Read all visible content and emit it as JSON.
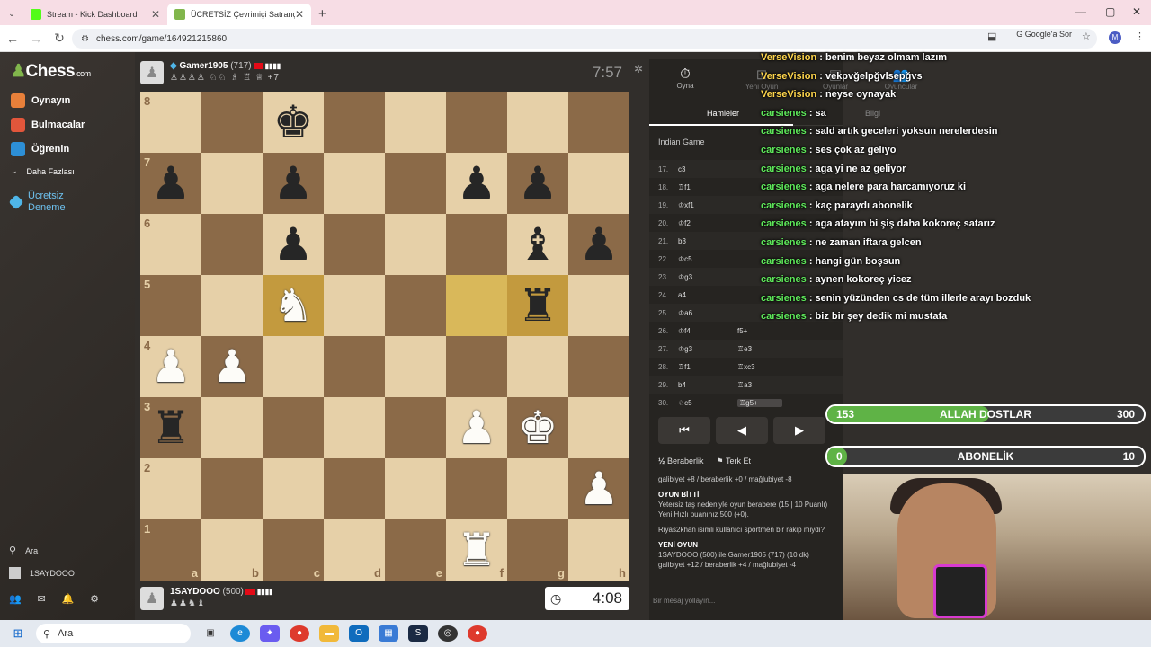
{
  "browser": {
    "tabs": [
      {
        "title": "Stream - Kick Dashboard",
        "close": "✕"
      },
      {
        "title": "ÜCRETSİZ Çevrimiçi Satranç Oy",
        "close": "✕"
      }
    ],
    "new_tab": "+",
    "url": "chess.com/game/164921215860",
    "google_sor": "Google'a Sor",
    "profile": "M"
  },
  "sidebar": {
    "logo": "Chess",
    "logo_suffix": ".com",
    "items": [
      "Oynayın",
      "Bulmacalar",
      "Öğrenin",
      "Daha Fazlası"
    ],
    "trial": "Ücretsiz Deneme",
    "search": "Ara",
    "user": "1SAYDOOO"
  },
  "top_player": {
    "name": "Gamer1905",
    "rating": "(717)",
    "captured": "♙♙♙♙ ♘♘ ♗ ♖ ♕ +7",
    "clock": "7:57"
  },
  "bottom_player": {
    "name": "1SAYDOOO",
    "rating": "(500)",
    "captured": "♟♟♞♝",
    "clock": "4:08"
  },
  "board": {
    "ranks": [
      "8",
      "7",
      "6",
      "5",
      "4",
      "3",
      "2",
      "1"
    ],
    "files": [
      "a",
      "b",
      "c",
      "d",
      "e",
      "f",
      "g",
      "h"
    ],
    "highlight": [
      "c5",
      "f5",
      "g5"
    ],
    "pieces": {
      "c8": "bk",
      "a7": "bp",
      "c7": "bp",
      "f7": "bp",
      "g7": "bp",
      "c6": "bp",
      "g6": "bb",
      "h6": "bp",
      "c5": "wn",
      "g5": "br",
      "a4": "wp",
      "b4": "wp",
      "a3": "br",
      "f3": "wp",
      "g3": "wk",
      "h2": "wp",
      "f1": "wr"
    }
  },
  "panel": {
    "tabs": [
      "Oyna",
      "Yeni Oyun",
      "Oyunlar",
      "Oyuncular"
    ],
    "subtabs": [
      "Hamleler",
      "Bilgi"
    ],
    "opening": "Indian Game",
    "moves": [
      {
        "n": "17.",
        "w": "c3",
        "b": ""
      },
      {
        "n": "18.",
        "w": "♖f1",
        "b": ""
      },
      {
        "n": "19.",
        "w": "♔xf1",
        "b": ""
      },
      {
        "n": "20.",
        "w": "♔f2",
        "b": ""
      },
      {
        "n": "21.",
        "w": "b3",
        "b": ""
      },
      {
        "n": "22.",
        "w": "♔c5",
        "b": ""
      },
      {
        "n": "23.",
        "w": "♔g3",
        "b": ""
      },
      {
        "n": "24.",
        "w": "a4",
        "b": ""
      },
      {
        "n": "25.",
        "w": "♔a6",
        "b": ""
      },
      {
        "n": "26.",
        "w": "♔f4",
        "b": "f5+"
      },
      {
        "n": "27.",
        "w": "♔g3",
        "b": "♖e3"
      },
      {
        "n": "28.",
        "w": "♖f1",
        "b": "♖xc3"
      },
      {
        "n": "29.",
        "w": "b4",
        "b": "♖a3"
      },
      {
        "n": "30.",
        "w": "♘c5",
        "b": "♖g5+"
      }
    ],
    "controls": [
      "⏮",
      "◀",
      "▶",
      "▶",
      "⏭"
    ],
    "draw": "Beraberlik",
    "resign": "Terk Et",
    "info": {
      "line1": "galibiyet +8 / beraberlik +0 / mağlubiyet -8",
      "over_title": "OYUN BİTTİ",
      "over_text": "Yetersiz taş nedeniyle oyun berabere (15 | 10 Puanlı)",
      "rating_text": "Yeni Hızlı puanınız 500 (+0).",
      "sportsman": "Riyas2khan isimli kullanıcı sportmen bir rakip miydi?",
      "new_title": "YENİ OYUN",
      "new_text": "1SAYDOOO (500) ile Gamer1905 (717) (10 dk)",
      "new_line": "galibiyet +12 / beraberlik +4 / mağlubiyet -4"
    },
    "message_placeholder": "Bir mesaj yollayın..."
  },
  "chat": [
    {
      "user": "VerseVision",
      "type": "u1",
      "msg": "benim beyaz olmam lazım"
    },
    {
      "user": "VerseVision",
      "type": "u1",
      "msg": "vekpvğelpğvlsepğvs"
    },
    {
      "user": "VerseVision",
      "type": "u1",
      "msg": "neyse oynayak"
    },
    {
      "user": "carsienes",
      "type": "u2",
      "msg": "sa"
    },
    {
      "user": "carsienes",
      "type": "u2",
      "msg": "sald artık geceleri yoksun nerelerdesin"
    },
    {
      "user": "carsienes",
      "type": "u2",
      "msg": "ses çok az geliyo"
    },
    {
      "user": "carsienes",
      "type": "u2",
      "msg": "aga yi ne az geliyor"
    },
    {
      "user": "carsienes",
      "type": "u2",
      "msg": "aga nelere para harcamıyoruz ki"
    },
    {
      "user": "carsienes",
      "type": "u2",
      "msg": "kaç paraydı abonelik"
    },
    {
      "user": "carsienes",
      "type": "u2",
      "msg": "aga atayım bi şiş daha kokoreç satarız"
    },
    {
      "user": "carsienes",
      "type": "u2",
      "msg": "ne zaman iftara gelcen"
    },
    {
      "user": "carsienes",
      "type": "u2",
      "msg": "hangi gün boşsun"
    },
    {
      "user": "carsienes",
      "type": "u2",
      "msg": "aynen kokoreç yicez"
    },
    {
      "user": "carsienes",
      "type": "u2",
      "msg": "senin yüzünden cs de tüm illerle arayı bozduk"
    },
    {
      "user": "carsienes",
      "type": "u2",
      "msg": "biz bir şey dedik mi mustafa"
    }
  ],
  "goal1": {
    "current": "153",
    "label": "ALLAH DOSTLAR",
    "target": "300",
    "progress": 0.51
  },
  "goal2": {
    "current": "0",
    "label": "ABONELİK",
    "target": "10",
    "progress": 0.0
  },
  "taskbar": {
    "search": "Ara"
  }
}
